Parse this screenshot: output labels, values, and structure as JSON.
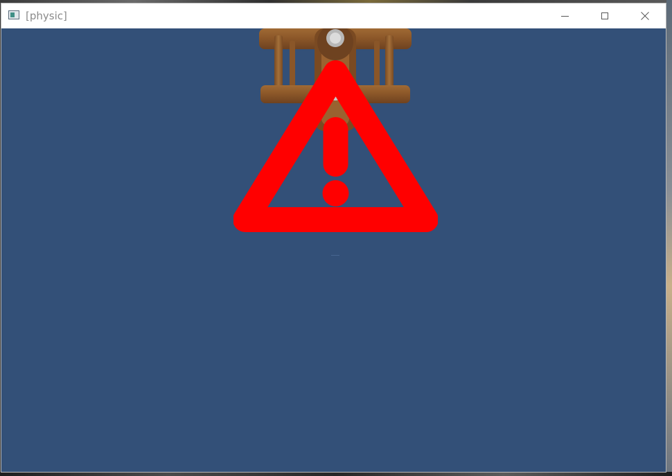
{
  "window": {
    "title": "[physic]",
    "controls": {
      "minimize": "minimize",
      "maximize": "maximize",
      "close": "close"
    }
  },
  "viewport": {
    "background_color": "#335078",
    "sprite": "biplane-sprite",
    "overlay_icon": "warning-triangle-icon",
    "overlay_color": "#ff0000"
  }
}
